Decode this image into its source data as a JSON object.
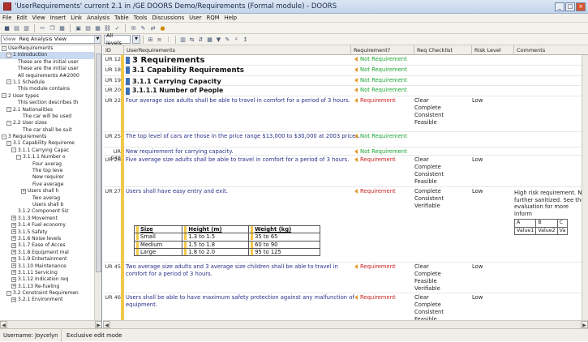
{
  "window": {
    "title": "'UserRequirements' current 2.1 in /GE DOORS Demo/Requirements (Formal module) - DOORS"
  },
  "menu": [
    "File",
    "Edit",
    "View",
    "Insert",
    "Link",
    "Analysis",
    "Table",
    "Tools",
    "Discussions",
    "User",
    "RQM",
    "Help"
  ],
  "toolbar2": {
    "view_label": "View",
    "view_value": "Req Analysis View",
    "levels_value": "All levels"
  },
  "tree": [
    {
      "label": "UserRequirements",
      "indent": 0,
      "ex": "-"
    },
    {
      "label": "1 Introduction",
      "indent": 1,
      "ex": "-",
      "selected": true
    },
    {
      "label": "These are the initial user",
      "indent": 2,
      "ex": ""
    },
    {
      "label": "These are the initial user",
      "indent": 2,
      "ex": ""
    },
    {
      "label": "All requirements A#2000",
      "indent": 2,
      "ex": ""
    },
    {
      "label": "1.1 Schedule",
      "indent": 1,
      "ex": "-"
    },
    {
      "label": "This module contains",
      "indent": 2,
      "ex": ""
    },
    {
      "label": "2 User types",
      "indent": 0,
      "ex": "-"
    },
    {
      "label": "This section describes th",
      "indent": 2,
      "ex": ""
    },
    {
      "label": "2.1 Nationalities",
      "indent": 1,
      "ex": "-"
    },
    {
      "label": "The car will be used",
      "indent": 3,
      "ex": ""
    },
    {
      "label": "2.2 User sizes",
      "indent": 1,
      "ex": "-"
    },
    {
      "label": "The car shall be suit",
      "indent": 3,
      "ex": ""
    },
    {
      "label": "3 Requirements",
      "indent": 0,
      "ex": "-"
    },
    {
      "label": "3.1 Capability Requireme",
      "indent": 1,
      "ex": "-"
    },
    {
      "label": "3.1.1 Carrying Capac",
      "indent": 2,
      "ex": "-"
    },
    {
      "label": "3.1.1.1 Number o",
      "indent": 3,
      "ex": "-"
    },
    {
      "label": "Four averag",
      "indent": 5,
      "ex": ""
    },
    {
      "label": "The top leve",
      "indent": 5,
      "ex": ""
    },
    {
      "label": "New requirer",
      "indent": 5,
      "ex": ""
    },
    {
      "label": "Five average",
      "indent": 5,
      "ex": ""
    },
    {
      "label": "Users shall h",
      "indent": 4,
      "ex": "+"
    },
    {
      "label": "Two averag",
      "indent": 5,
      "ex": ""
    },
    {
      "label": "Users shall b",
      "indent": 5,
      "ex": ""
    },
    {
      "label": "3.1.2 Component Siz",
      "indent": 2,
      "ex": ""
    },
    {
      "label": "3.1.3 Movement",
      "indent": 2,
      "ex": "+"
    },
    {
      "label": "3.1.4 Fuel economy",
      "indent": 2,
      "ex": "+"
    },
    {
      "label": "3.1.5 Safety",
      "indent": 2,
      "ex": "+"
    },
    {
      "label": "3.1.6 Noise levels",
      "indent": 2,
      "ex": "+"
    },
    {
      "label": "3.1.7 Ease of Acces",
      "indent": 2,
      "ex": "+"
    },
    {
      "label": "3.1.8 Equipment mal",
      "indent": 2,
      "ex": "+"
    },
    {
      "label": "3.1.9 Entertainment",
      "indent": 2,
      "ex": "+"
    },
    {
      "label": "3.1.10 Maintenance",
      "indent": 2,
      "ex": "+"
    },
    {
      "label": "3.1.11 Servicing",
      "indent": 2,
      "ex": "+"
    },
    {
      "label": "3.1.12 Indication req",
      "indent": 2,
      "ex": "+"
    },
    {
      "label": "3.1.13 Re-fueling",
      "indent": 2,
      "ex": "+"
    },
    {
      "label": "3.2 Constraint Requiremen",
      "indent": 1,
      "ex": "-"
    },
    {
      "label": "3.2.1 Environment",
      "indent": 2,
      "ex": "+"
    }
  ],
  "columns": {
    "id": "ID",
    "text": "UserRequirements",
    "req": "Requirement?",
    "chk": "Req Checklist",
    "risk": "Risk Level",
    "com": "Comments"
  },
  "rows": [
    {
      "id": "UR 12",
      "text": "3 Requirements",
      "style": "h1",
      "req": "Not Requirement",
      "isreq": false,
      "chk": "",
      "risk": "",
      "com": ""
    },
    {
      "id": "UR 18",
      "text": "3.1 Capability Requirements",
      "style": "h2",
      "req": "Not Requirement",
      "isreq": false,
      "chk": "",
      "risk": "",
      "com": ""
    },
    {
      "id": "UR 19",
      "text": "3.1.1 Carrying Capacity",
      "style": "h3",
      "req": "Not Requirement",
      "isreq": false,
      "chk": "",
      "risk": "",
      "com": ""
    },
    {
      "id": "UR 20",
      "text": "3.1.1.1 Number of People",
      "style": "h4",
      "req": "Not Requirement",
      "isreq": false,
      "chk": "",
      "risk": "",
      "com": ""
    },
    {
      "id": "UR 22",
      "text": "Four average size adults shall be able to travel in comfort for a period of 3 hours.",
      "style": "",
      "req": "Requirement",
      "isreq": true,
      "chk": "Clear\nComplete\nConsistent\nFeasible",
      "risk": "Low",
      "com": ""
    },
    {
      "id": "UR 25",
      "text": "The top level of cars are those in the price range $13,000 to $30,000 at 2003 prices.",
      "style": "",
      "req": "Not Requirement",
      "isreq": false,
      "chk": "",
      "risk": "",
      "com": ""
    },
    {
      "id": "UR 948",
      "text": "New requirement for carrying capacity.",
      "style": "",
      "req": "Not Requirement",
      "isreq": false,
      "chk": "",
      "risk": "",
      "com": ""
    },
    {
      "id": "UR 26",
      "text": "Five average size adults shall be able to travel in comfort for a period of 3 hours.",
      "style": "",
      "req": "Requirement",
      "isreq": true,
      "chk": "Clear\nComplete\nConsistent\nFeasible",
      "risk": "Low",
      "com": ""
    },
    {
      "id": "UR 27",
      "text": "Users shall have easy entry and exit.",
      "style": "",
      "req": "Requirement",
      "isreq": true,
      "chk": "Complete\nConsistent\nVerifiable",
      "risk": "Low",
      "com": "High risk requirement. Ne\nfurther sanitized. See the\nevaluation for more inform"
    },
    {
      "id": "UR 45",
      "text": "Two average size adults and 3 average size children shall be able to travel in comfort for a period of 3 hours.",
      "style": "",
      "req": "Requirement",
      "isreq": true,
      "chk": "Clear\nComplete\nFeasible\nVerifiable",
      "risk": "Low",
      "com": ""
    },
    {
      "id": "UR 46",
      "text": "Users shall be able to have maximum safety protection against any malfunction of equipment.",
      "style": "",
      "req": "Requirement",
      "isreq": true,
      "chk": "Clear\nComplete\nConsistent\nFeasible",
      "risk": "Low",
      "com": ""
    }
  ],
  "comment_table": {
    "head": [
      "A",
      "B",
      "C"
    ],
    "cells": [
      "Value1",
      "Value2",
      "Va"
    ]
  },
  "size_table": {
    "header": [
      "Size",
      "Height (m)",
      "Weight (kg)"
    ],
    "rows": [
      [
        "Small",
        "1.3 to 1.5",
        "35 to 65"
      ],
      [
        "Medium",
        "1.5 to 1.8",
        "60 to 90"
      ],
      [
        "Large",
        "1.8 to 2.0",
        "95 to 125"
      ]
    ]
  },
  "status": {
    "user": "Username: Joycelyn",
    "mode": "Exclusive edit mode"
  },
  "colors": {
    "requirement": "#c41e1e",
    "not_requirement": "#1aa531",
    "level_bar": "#f2c84a",
    "heading_mark": "#3b6fb5"
  }
}
